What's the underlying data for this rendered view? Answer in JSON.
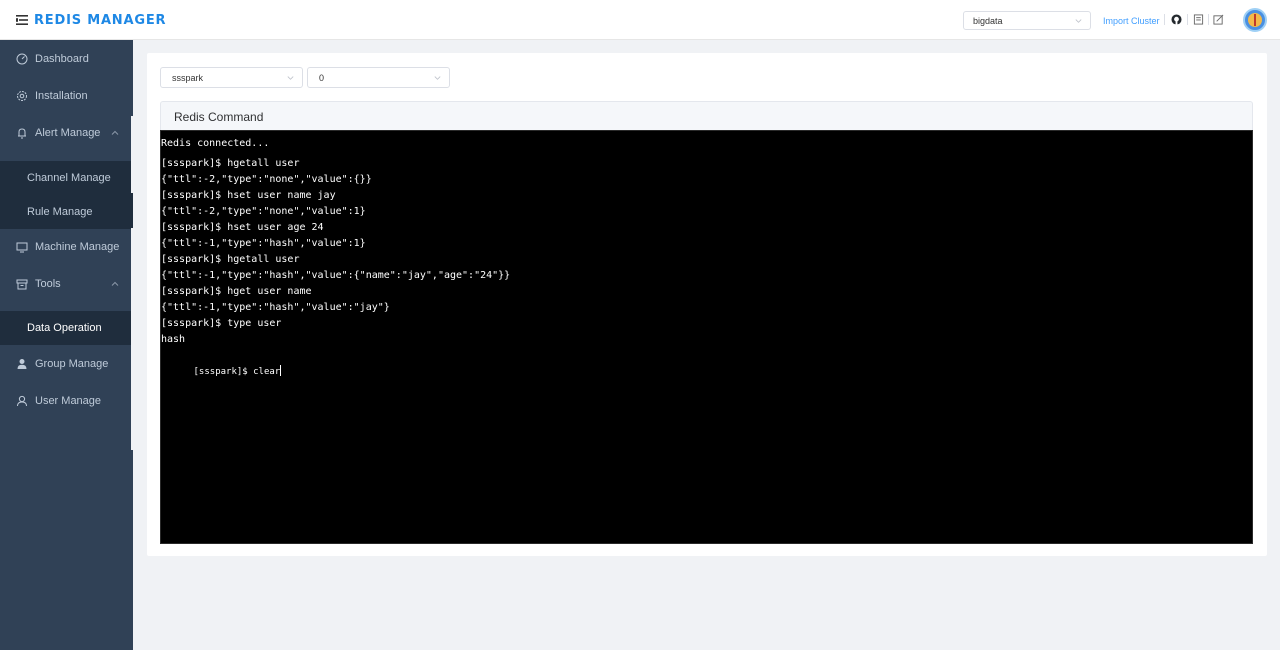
{
  "header": {
    "logo_text": "REDIS MANAGER",
    "cluster_select": "bigdata",
    "import_link": "Import Cluster",
    "icons": [
      "menu-icon",
      "github-icon",
      "doc-icon",
      "edit-icon",
      "avatar"
    ]
  },
  "sidebar": {
    "items": [
      {
        "label": "Dashboard",
        "icon": "dashboard-icon"
      },
      {
        "label": "Installation",
        "icon": "gear-icon"
      },
      {
        "label": "Alert Manage",
        "icon": "bell-icon"
      },
      {
        "label": "Channel Manage"
      },
      {
        "label": "Rule Manage"
      },
      {
        "label": "Machine Manage",
        "icon": "monitor-icon"
      },
      {
        "label": "Tools",
        "icon": "box-icon"
      },
      {
        "label": "Data Operation"
      },
      {
        "label": "Group Manage",
        "icon": "user-solid-icon"
      },
      {
        "label": "User Manage",
        "icon": "user-icon"
      }
    ],
    "active": "Data Operation"
  },
  "main": {
    "node_select": "ssspark",
    "db_select": "0",
    "panel_title": "Redis Command",
    "terminal_lines": [
      "Redis connected...",
      "[ssspark]$ hgetall user",
      "{\"ttl\":-2,\"type\":\"none\",\"value\":{}}",
      "[ssspark]$ hset user name jay",
      "{\"ttl\":-2,\"type\":\"none\",\"value\":1}",
      "[ssspark]$ hset user age 24",
      "{\"ttl\":-1,\"type\":\"hash\",\"value\":1}",
      "[ssspark]$ hgetall user",
      "{\"ttl\":-1,\"type\":\"hash\",\"value\":{\"name\":\"jay\",\"age\":\"24\"}}",
      "[ssspark]$ hget user name",
      "{\"ttl\":-1,\"type\":\"hash\",\"value\":\"jay\"}",
      "[ssspark]$ type user",
      "hash"
    ],
    "terminal_prompt": "[ssspark]$ clear"
  },
  "colors": {
    "sidebar_bg": "#304156",
    "submenu_bg": "#1f2d3d",
    "accent": "#409eff",
    "logo": "#1e88e5",
    "terminal_bg": "#000000"
  }
}
